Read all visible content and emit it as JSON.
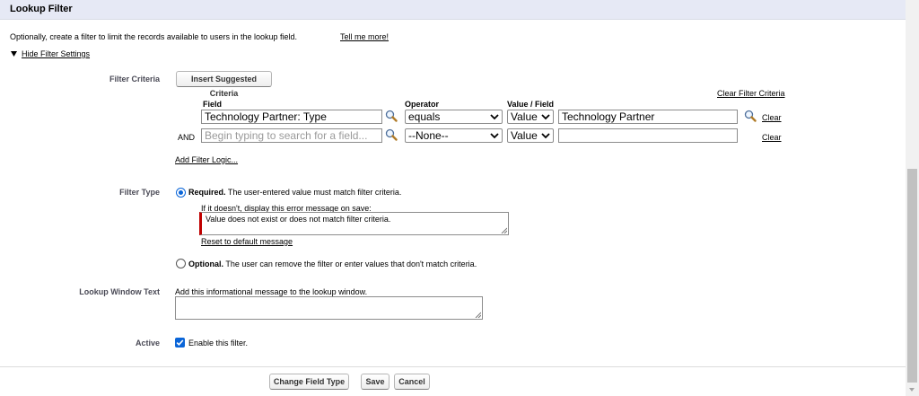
{
  "section": {
    "title": "Lookup Filter"
  },
  "intro": {
    "text": "Optionally, create a filter to limit the records available to users in the lookup field.",
    "link": "Tell me more!"
  },
  "toggle": {
    "label": "Hide Filter Settings"
  },
  "criteria": {
    "label": "Filter Criteria",
    "insert_button": "Insert Suggested Criteria",
    "clear_all": "Clear Filter Criteria",
    "headers": {
      "field": "Field",
      "operator": "Operator",
      "value_field": "Value / Field"
    },
    "rows": [
      {
        "prefix": "",
        "field_value": "Technology Partner: Type",
        "field_placeholder": "",
        "operator": "equals",
        "value_type": "Value",
        "value": "Technology Partner",
        "clear": "Clear"
      },
      {
        "prefix": "AND",
        "field_value": "",
        "field_placeholder": "Begin typing to search for a field...",
        "operator": "--None--",
        "value_type": "Value",
        "value": "",
        "clear": "Clear"
      }
    ],
    "add_logic": "Add Filter Logic..."
  },
  "filter_type": {
    "label": "Filter Type",
    "required_title": "Required.",
    "required_desc": "The user-entered value must match filter criteria.",
    "error_prompt": "If it doesn't, display this error message on save:",
    "error_message": "Value does not exist or does not match filter criteria.",
    "reset_link": "Reset to default message",
    "optional_title": "Optional.",
    "optional_desc": "The user can remove the filter or enter values that don't match criteria.",
    "selected": "required"
  },
  "lookup_window": {
    "label": "Lookup Window Text",
    "prompt": "Add this informational message to the lookup window.",
    "value": ""
  },
  "active": {
    "label": "Active",
    "checkbox_label": "Enable this filter.",
    "checked": true
  },
  "footer": {
    "change_type": "Change Field Type",
    "save": "Save",
    "cancel": "Cancel"
  },
  "icons": {
    "lookup": "magnifier-lookup-icon",
    "toggle": "triangle-down-icon",
    "chevron": "chevron-down-icon",
    "check": "checkmark-icon"
  },
  "colors": {
    "header_bg": "#e6e9f5",
    "accent": "#0a65d8",
    "error_bar": "#c00000"
  }
}
